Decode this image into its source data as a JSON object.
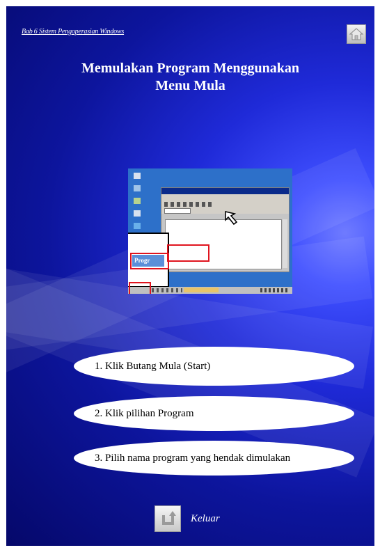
{
  "header": {
    "chapter_link": "Bab 6 Sistem Pengoperasian Windows"
  },
  "title": {
    "line1": "Memulakan Program Menggunakan",
    "line2": "Menu Mula"
  },
  "screenshot": {
    "program_label": "Progr"
  },
  "steps": [
    {
      "label": "1. Klik Butang Mula (Start)"
    },
    {
      "label": "2. Klik pilihan Program"
    },
    {
      "label": "3. Pilih nama program yang hendak dimulakan"
    }
  ],
  "footer": {
    "exit_label": "Keluar"
  },
  "icons": {
    "home": "home-icon",
    "exit": "return-arrow-icon",
    "cursor": "arrow-cursor-icon"
  },
  "colors": {
    "background": "#0d159d",
    "highlight_box": "#e0141e",
    "taskbar": "#c0c0c0"
  }
}
